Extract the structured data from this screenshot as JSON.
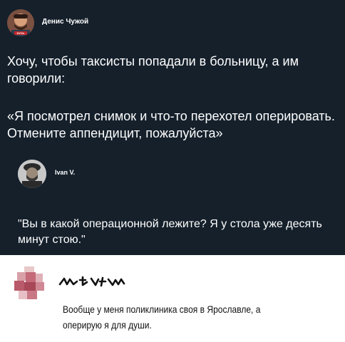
{
  "tweet": {
    "author": "Денис Чужой",
    "avatar_caption": "КУСЬ",
    "text_line_1": "Хочу, чтобы таксисты попадали в больницу, а им говорили:",
    "text_line_2": "«Я посмотрел снимок и что-то перехотел оперировать. Отмените аппендицит, пожалуйста»"
  },
  "reply": {
    "author": "Ivan V.",
    "text": "\"Вы в какой операционной лежите? Я у стола уже десять минут стою.\""
  },
  "comment": {
    "text": "Вообще у меня поликлиника своя в Ярославле, а оперирую я для души."
  }
}
